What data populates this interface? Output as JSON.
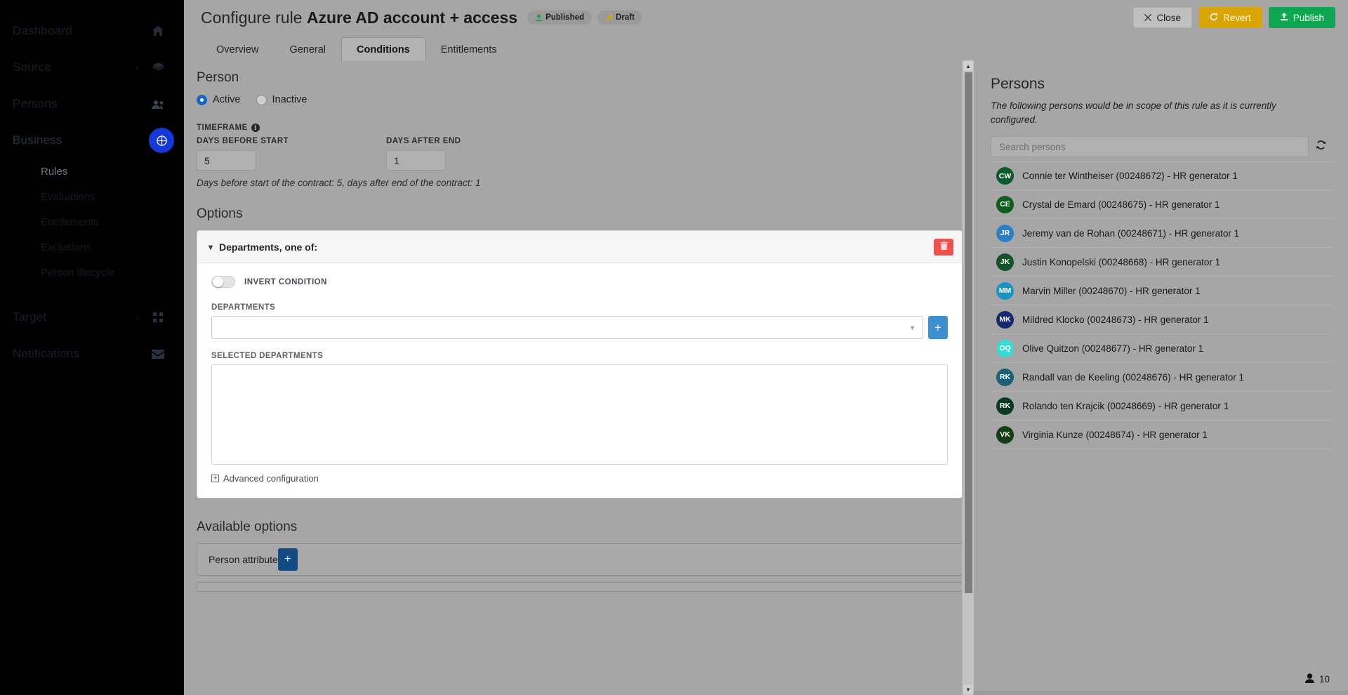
{
  "sidebar": {
    "items": [
      {
        "label": "Dashboard",
        "icon": "home-icon",
        "chevron": "",
        "state": "dim"
      },
      {
        "label": "Source",
        "icon": "layers-icon",
        "chevron": "‹",
        "state": "dim"
      },
      {
        "label": "Persons",
        "icon": "people-icon",
        "chevron": "",
        "state": "dim"
      },
      {
        "label": "Business",
        "icon": "business-icon",
        "chevron": "⌄",
        "state": "active"
      }
    ],
    "sub_items": [
      {
        "label": "Rules",
        "selected": true
      },
      {
        "label": "Evaluations",
        "selected": false
      },
      {
        "label": "Entitlements",
        "selected": false
      },
      {
        "label": "Exclusions",
        "selected": false
      },
      {
        "label": "Person lifecycle",
        "selected": false
      }
    ],
    "items_bottom": [
      {
        "label": "Target",
        "icon": "grid-icon",
        "chevron": "‹"
      },
      {
        "label": "Notifications",
        "icon": "mail-icon",
        "chevron": ""
      }
    ]
  },
  "header": {
    "title_prefix": "Configure rule ",
    "title_name": "Azure AD account + access",
    "badges": [
      {
        "label": "Published",
        "icon": "publish-icon",
        "color": "#1e9e4a"
      },
      {
        "label": "Draft",
        "icon": "pencil-icon",
        "color": "#d9a406"
      }
    ],
    "actions": {
      "close": "Close",
      "revert": "Revert",
      "publish": "Publish"
    }
  },
  "tabs": [
    {
      "label": "Overview",
      "active": false
    },
    {
      "label": "General",
      "active": false
    },
    {
      "label": "Conditions",
      "active": true
    },
    {
      "label": "Entitlements",
      "active": false
    }
  ],
  "form": {
    "person_section_title": "Person",
    "status_options": [
      {
        "label": "Active",
        "checked": true
      },
      {
        "label": "Inactive",
        "checked": false
      }
    ],
    "timeframe_label": "TIMEFRAME",
    "days_before_start_label": "DAYS BEFORE START",
    "days_before_start_value": "5",
    "days_after_end_label": "DAYS AFTER END",
    "days_after_end_value": "1",
    "timeframe_help": "Days before start of the contract: 5, days after end of the contract: 1",
    "options_title": "Options",
    "condition": {
      "title": "Departments, one of:",
      "invert_label": "INVERT CONDITION",
      "invert_on": false,
      "departments_label": "DEPARTMENTS",
      "departments_value": "",
      "selected_departments_label": "SELECTED DEPARTMENTS",
      "selected_departments": [],
      "advanced_label": "Advanced configuration"
    },
    "available_options_title": "Available options",
    "available_options": [
      {
        "label": "Person attribute"
      }
    ]
  },
  "persons": {
    "title": "Persons",
    "description": "The following persons would be in scope of this rule as it is currently configured.",
    "search_placeholder": "Search persons",
    "search_value": "",
    "count": "10",
    "list": [
      {
        "initials": "CW",
        "color": "#0c5b29",
        "name": "Connie ter Wintheiser (00248672) - HR generator 1"
      },
      {
        "initials": "CE",
        "color": "#0f5c1e",
        "name": "Crystal de Emard (00248675) - HR generator 1"
      },
      {
        "initials": "JR",
        "color": "#2c7fc4",
        "name": "Jeremy van de Rohan (00248671) - HR generator 1"
      },
      {
        "initials": "JK",
        "color": "#14532a",
        "name": "Justin Konopelski (00248668) - HR generator 1"
      },
      {
        "initials": "MM",
        "color": "#1595c4",
        "name": "Marvin Miller (00248670) - HR generator 1"
      },
      {
        "initials": "MK",
        "color": "#17296e",
        "name": "Mildred Klocko (00248673) - HR generator 1"
      },
      {
        "initials": "OQ",
        "color": "#36ddd4",
        "name": "Olive Quitzon (00248677) - HR generator 1"
      },
      {
        "initials": "RK",
        "color": "#1d5f76",
        "name": "Randall van de Keeling (00248676) - HR generator 1"
      },
      {
        "initials": "RK",
        "color": "#0c3a1f",
        "name": "Rolando ten Krajcik (00248669) - HR generator 1"
      },
      {
        "initials": "VK",
        "color": "#143d12",
        "name": "Virginia Kunze (00248674) - HR generator 1"
      }
    ]
  }
}
